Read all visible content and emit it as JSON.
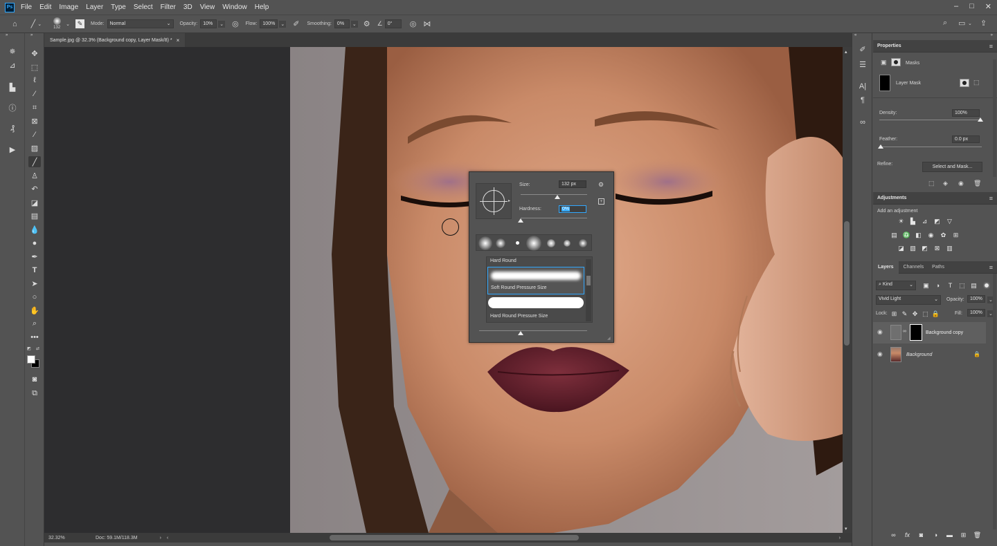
{
  "app": {
    "logo": "Ps"
  },
  "menu": [
    "File",
    "Edit",
    "Image",
    "Layer",
    "Type",
    "Select",
    "Filter",
    "3D",
    "View",
    "Window",
    "Help"
  ],
  "window_controls": {
    "minimize": "–",
    "restore": "□",
    "close": "✕"
  },
  "options_bar": {
    "brush_size": "132",
    "mode_label": "Mode:",
    "mode_value": "Normal",
    "opacity_label": "Opacity:",
    "opacity_value": "10%",
    "flow_label": "Flow:",
    "flow_value": "100%",
    "smoothing_label": "Smoothing:",
    "smoothing_value": "0%",
    "angle_value": "0°"
  },
  "document": {
    "tab_title": "Sample.jpg @ 32.3% (Background copy, Layer Mask/8) *",
    "tab_close": "×",
    "zoom": "32.32%",
    "doc_info": "Doc: 59.1M/118.3M"
  },
  "brush_popup": {
    "size_label": "Size:",
    "size_value": "132 px",
    "size_fraction": 0.55,
    "hardness_label": "Hardness:",
    "hardness_value": "0%",
    "hardness_fraction": 0.0,
    "presets": [
      {
        "name": "Hard Round"
      },
      {
        "name": "Soft Round Pressure Size"
      },
      {
        "name": "Hard Round Pressure Size"
      }
    ],
    "selected_preset": 1
  },
  "properties": {
    "title": "Properties",
    "masks_label": "Masks",
    "layer_mask_label": "Layer Mask",
    "density_label": "Density:",
    "density_value": "100%",
    "density_fraction": 1.0,
    "feather_label": "Feather:",
    "feather_value": "0.0 px",
    "feather_fraction": 0.0,
    "refine_label": "Refine:",
    "select_mask_button": "Select and Mask..."
  },
  "adjustments": {
    "title": "Adjustments",
    "subtitle": "Add an adjustment"
  },
  "layers": {
    "tabs": [
      "Layers",
      "Channels",
      "Paths"
    ],
    "active_tab": 0,
    "kind_filter": "Kind",
    "blend_mode": "Vivid Light",
    "opacity_label": "Opacity:",
    "opacity_value": "100%",
    "lock_label": "Lock:",
    "fill_label": "Fill:",
    "fill_value": "100%",
    "items": [
      {
        "name": "Background copy",
        "selected": true
      },
      {
        "name": "Background",
        "selected": false
      }
    ]
  },
  "colors": {
    "accent": "#31a8ff",
    "ui_bg": "#535353",
    "panel_dark": "#424242",
    "canvas_bg": "#2d2d2f",
    "selection": "#5f5f5f"
  }
}
